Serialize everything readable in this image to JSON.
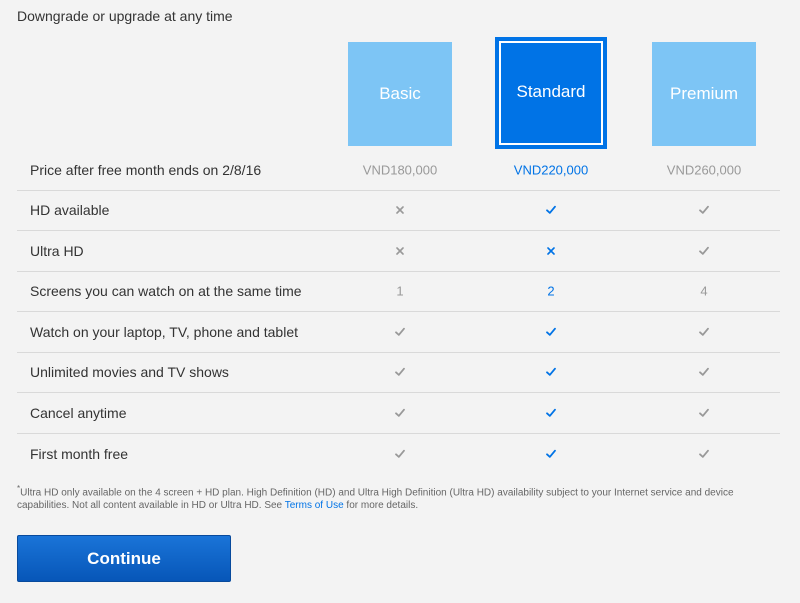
{
  "header": {
    "subtitle": "Downgrade or upgrade at any time"
  },
  "plans": [
    {
      "name": "Basic",
      "selected": false
    },
    {
      "name": "Standard",
      "selected": true
    },
    {
      "name": "Premium",
      "selected": false
    }
  ],
  "colors": {
    "selected_plan": "#0073e6",
    "unselected_plan": "#7dc5f5",
    "check_selected": "#0073e6",
    "check_muted": "#999999",
    "background": "#f3f3f3"
  },
  "comparison": {
    "price_row": {
      "label": "Price after free month ends on 2/8/16",
      "values": [
        "VND180,000",
        "VND220,000",
        "VND260,000"
      ]
    },
    "rows": [
      {
        "label": "HD available",
        "values": [
          "cross-icon",
          "check-icon",
          "check-icon"
        ]
      },
      {
        "label": "Ultra HD",
        "values": [
          "cross-icon",
          "cross-icon",
          "check-icon"
        ]
      },
      {
        "label": "Screens you can watch on at the same time",
        "values": [
          "1",
          "2",
          "4"
        ]
      },
      {
        "label": "Watch on your laptop, TV, phone and tablet",
        "values": [
          "check-icon",
          "check-icon",
          "check-icon"
        ]
      },
      {
        "label": "Unlimited movies and TV shows",
        "values": [
          "check-icon",
          "check-icon",
          "check-icon"
        ]
      },
      {
        "label": "Cancel anytime",
        "values": [
          "check-icon",
          "check-icon",
          "check-icon"
        ]
      },
      {
        "label": "First month free",
        "values": [
          "check-icon",
          "check-icon",
          "check-icon"
        ]
      }
    ]
  },
  "footnote": {
    "marker": "*",
    "text_before": "Ultra HD only available on the 4 screen + HD plan. High Definition (HD) and Ultra High Definition (Ultra HD) availability subject to your Internet service and device capabilities. Not all content available in HD or Ultra HD. See ",
    "link": "Terms of Use",
    "text_after": " for more details."
  },
  "actions": {
    "continue_label": "Continue"
  }
}
